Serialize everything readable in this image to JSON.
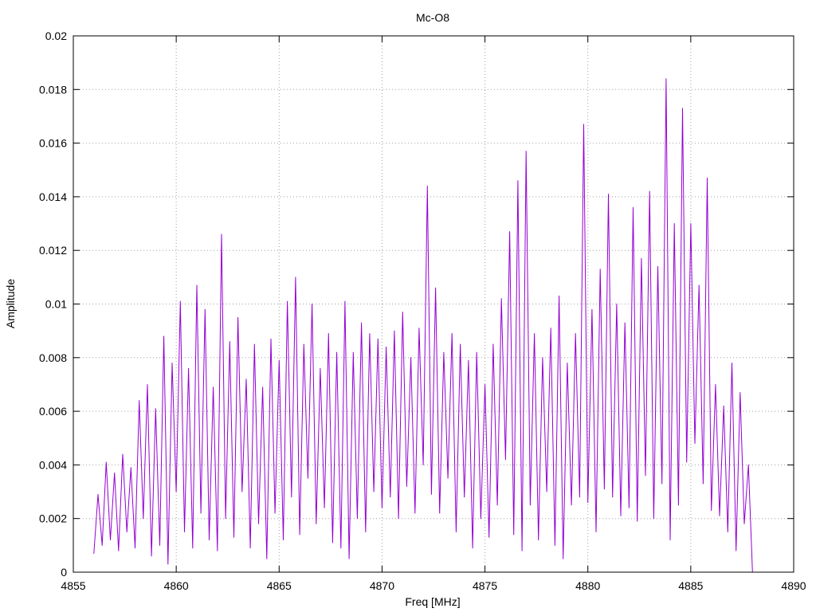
{
  "chart_data": {
    "type": "line",
    "title": "Mc-O8",
    "xlabel": "Freq [MHz]",
    "ylabel": "Amplitude",
    "xlim": [
      4855,
      4890
    ],
    "ylim": [
      0,
      0.02
    ],
    "xticks": [
      "4855",
      "4860",
      "4865",
      "4870",
      "4875",
      "4880",
      "4885",
      "4890"
    ],
    "yticks": [
      "0",
      "0.002",
      "0.004",
      "0.006",
      "0.008",
      "0.01",
      "0.012",
      "0.014",
      "0.016",
      "0.018",
      "0.02"
    ],
    "grid": true,
    "series": [
      {
        "name": "Mc-O8",
        "color": "#9400d3",
        "x_start": 4856,
        "x_step": 0.2,
        "y": [
          0.0007,
          0.0029,
          0.001,
          0.0041,
          0.0012,
          0.0037,
          0.0008,
          0.0044,
          0.0015,
          0.0039,
          0.0009,
          0.0064,
          0.002,
          0.007,
          0.0006,
          0.0061,
          0.001,
          0.0088,
          0.0003,
          0.0078,
          0.003,
          0.0101,
          0.0015,
          0.0076,
          0.0009,
          0.0107,
          0.0022,
          0.0098,
          0.0012,
          0.0069,
          0.0008,
          0.0126,
          0.002,
          0.0086,
          0.0013,
          0.0095,
          0.003,
          0.0072,
          0.0009,
          0.0085,
          0.0018,
          0.0069,
          0.0005,
          0.0087,
          0.0022,
          0.0079,
          0.0012,
          0.0101,
          0.0028,
          0.011,
          0.0014,
          0.0085,
          0.0035,
          0.01,
          0.0018,
          0.0076,
          0.0024,
          0.0089,
          0.0011,
          0.0082,
          0.0009,
          0.0101,
          0.0005,
          0.0082,
          0.002,
          0.0093,
          0.0015,
          0.0089,
          0.003,
          0.0087,
          0.0024,
          0.0084,
          0.0028,
          0.009,
          0.002,
          0.0097,
          0.0032,
          0.008,
          0.0022,
          0.0091,
          0.004,
          0.0144,
          0.0029,
          0.0106,
          0.0022,
          0.0082,
          0.0035,
          0.0089,
          0.0015,
          0.0085,
          0.0028,
          0.0079,
          0.0009,
          0.0082,
          0.002,
          0.007,
          0.0013,
          0.0085,
          0.0025,
          0.0102,
          0.0042,
          0.0127,
          0.0014,
          0.0146,
          0.0008,
          0.0157,
          0.0025,
          0.0089,
          0.0012,
          0.008,
          0.003,
          0.0091,
          0.001,
          0.0103,
          0.0005,
          0.0078,
          0.0025,
          0.0089,
          0.0028,
          0.0167,
          0.0026,
          0.0098,
          0.0015,
          0.0113,
          0.0031,
          0.0141,
          0.0028,
          0.01,
          0.0021,
          0.0093,
          0.0024,
          0.0136,
          0.0019,
          0.0117,
          0.0036,
          0.0142,
          0.002,
          0.0114,
          0.0033,
          0.0184,
          0.0012,
          0.013,
          0.0025,
          0.0173,
          0.0041,
          0.013,
          0.0048,
          0.0107,
          0.0033,
          0.0147,
          0.0023,
          0.007,
          0.0021,
          0.0062,
          0.0015,
          0.0078,
          0.0008,
          0.0067,
          0.0018,
          0.004,
          0.0
        ]
      }
    ]
  }
}
